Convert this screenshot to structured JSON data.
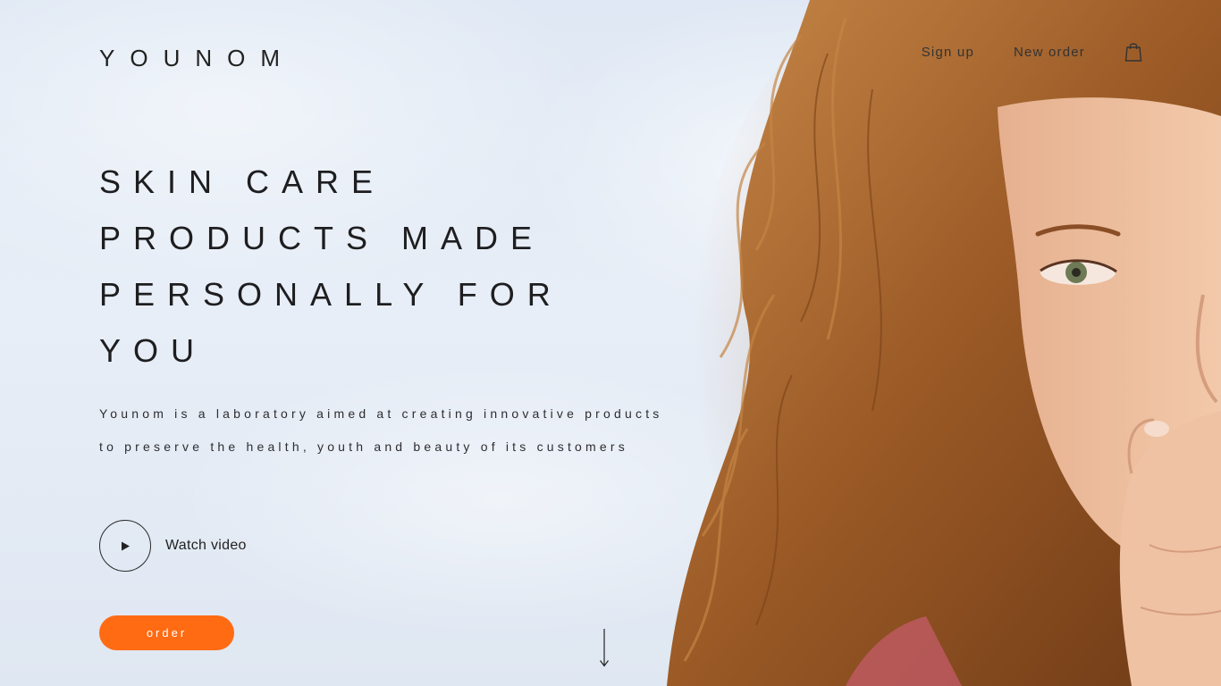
{
  "brand": {
    "logo_text": "YOUNOM"
  },
  "nav": {
    "signup_label": "Sign up",
    "new_order_label": "New order",
    "cart_icon": "shopping-bag-icon"
  },
  "hero": {
    "headline_lines": [
      "SKIN CARE",
      "PRODUCTS MADE",
      "PERSONALLY FOR",
      "YOU"
    ],
    "description": "Younom is a laboratory aimed at creating innovative products to preserve the health, youth and beauty of its customers",
    "watch_video_label": "Watch video",
    "play_icon": "play-icon",
    "order_label": "order",
    "scroll_icon": "arrow-down-icon"
  },
  "colors": {
    "accent": "#ff6b13",
    "text": "#1e1e20",
    "sky": "#e3ebf6"
  }
}
